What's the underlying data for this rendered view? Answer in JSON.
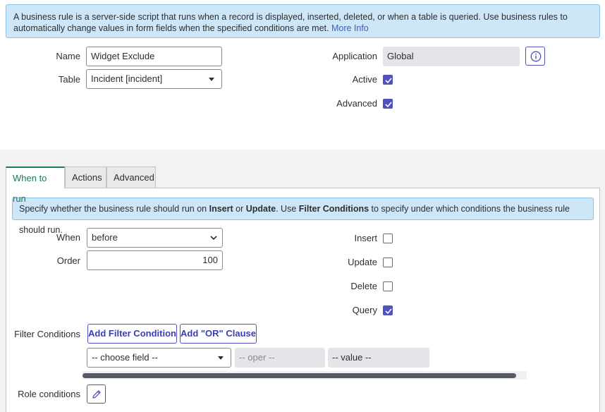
{
  "info_banner": {
    "text": "A business rule is a server-side script that runs when a record is displayed, inserted, deleted, or when a table is queried. Use business rules to automatically change values in form fields when the specified conditions are met.",
    "more_info": "More Info"
  },
  "form": {
    "name_label": "Name",
    "name_value": "Widget Exclude",
    "table_label": "Table",
    "table_value": "Incident [incident]",
    "application_label": "Application",
    "application_value": "Global",
    "active_label": "Active",
    "active_checked": true,
    "advanced_label": "Advanced",
    "advanced_checked": true
  },
  "tabs": [
    {
      "label": "When to run",
      "active": true
    },
    {
      "label": "Actions",
      "active": false
    },
    {
      "label": "Advanced",
      "active": false
    }
  ],
  "when_to_run": {
    "banner": {
      "p1": "Specify whether the business rule should run on ",
      "b1": "Insert",
      "p2": " or ",
      "b2": "Update",
      "p3": ". Use ",
      "b3": "Filter Conditions",
      "p4": " to specify under which conditions the business rule should run."
    },
    "when_label": "When",
    "when_value": "before",
    "order_label": "Order",
    "order_value": "100",
    "insert_label": "Insert",
    "insert_checked": false,
    "update_label": "Update",
    "update_checked": false,
    "delete_label": "Delete",
    "delete_checked": false,
    "query_label": "Query",
    "query_checked": true,
    "filter_conditions_label": "Filter Conditions",
    "add_filter_condition": "Add Filter Condition",
    "add_or_clause": "Add \"OR\" Clause",
    "choose_field": "-- choose field --",
    "oper_placeholder": "-- oper --",
    "value_placeholder": "-- value --",
    "role_conditions_label": "Role conditions"
  },
  "colors": {
    "accent": "#4f52bd",
    "active_tab": "#1a7a5a",
    "banner_bg": "#cde6f8",
    "link": "#3b5fc4"
  }
}
